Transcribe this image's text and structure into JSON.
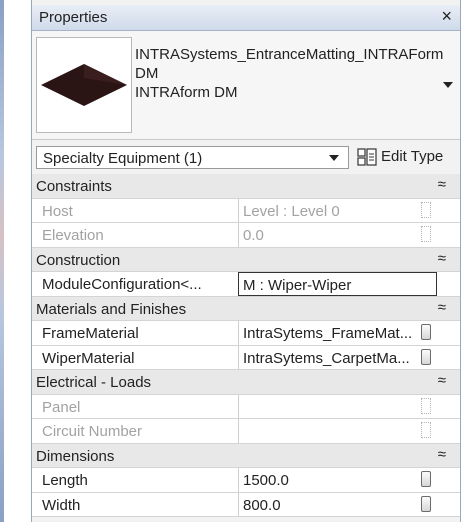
{
  "titlebar": {
    "title": "Properties",
    "close": "×"
  },
  "type_selector": {
    "family_name": "INTRASystems_EntranceMatting_INTRAFormDM",
    "type_name": "INTRAform DM"
  },
  "instance_selector": {
    "selected": "Specialty Equipment (1)",
    "edit_type_label": "Edit Type"
  },
  "groups": {
    "constraints": {
      "label": "Constraints",
      "toggle": "≈",
      "host": {
        "name": "Host",
        "value": "Level : Level 0"
      },
      "elevation": {
        "name": "Elevation",
        "value": "0.0"
      }
    },
    "construction": {
      "label": "Construction",
      "toggle": "≈",
      "module": {
        "name": "ModuleConfiguration<...",
        "value": "M : Wiper-Wiper"
      }
    },
    "materials": {
      "label": "Materials and Finishes",
      "toggle": "≈",
      "frame": {
        "name": "FrameMaterial",
        "value": "IntraSytems_FrameMat..."
      },
      "wiper": {
        "name": "WiperMaterial",
        "value": "IntraSytems_CarpetMa..."
      }
    },
    "electrical": {
      "label": "Electrical - Loads",
      "toggle": "≈",
      "panel": {
        "name": "Panel",
        "value": ""
      },
      "circuit": {
        "name": "Circuit Number",
        "value": ""
      }
    },
    "dimensions": {
      "label": "Dimensions",
      "toggle": "≈",
      "length": {
        "name": "Length",
        "value": "1500.0"
      },
      "width": {
        "name": "Width",
        "value": "800.0"
      }
    }
  }
}
